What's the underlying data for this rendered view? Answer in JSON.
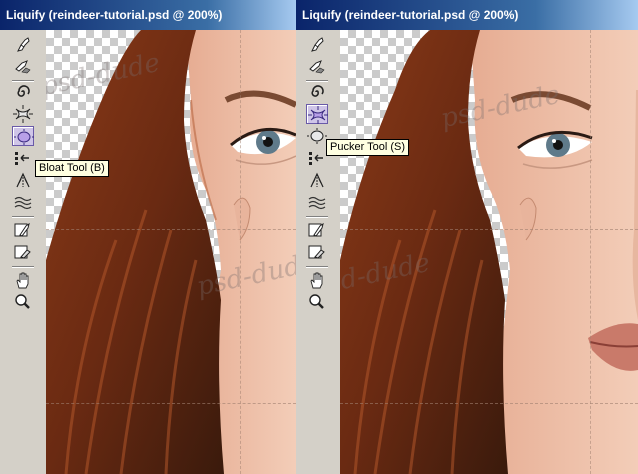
{
  "windows": [
    {
      "title": "Liquify (reindeer-tutorial.psd @ 200%)",
      "active_tool": "bloat",
      "tooltip": "Bloat Tool (B)",
      "watermark": "psd-dude"
    },
    {
      "title": "Liquify (reindeer-tutorial.psd @ 200%)",
      "active_tool": "pucker",
      "tooltip": "Pucker Tool (S)",
      "watermark": "psd-dude"
    }
  ],
  "tools": [
    {
      "name": "forward-warp",
      "icon": "finger-brush-icon"
    },
    {
      "name": "reconstruct",
      "icon": "reconstruct-brush-icon"
    },
    {
      "name": "twirl",
      "icon": "twirl-icon"
    },
    {
      "name": "pucker",
      "icon": "pucker-icon"
    },
    {
      "name": "bloat",
      "icon": "bloat-icon"
    },
    {
      "name": "push-left",
      "icon": "push-left-icon"
    },
    {
      "name": "mirror",
      "icon": "mirror-icon"
    },
    {
      "name": "turbulence",
      "icon": "turbulence-icon"
    },
    {
      "name": "freeze-mask",
      "icon": "freeze-mask-icon"
    },
    {
      "name": "thaw-mask",
      "icon": "thaw-mask-icon"
    },
    {
      "name": "hand",
      "icon": "hand-icon"
    },
    {
      "name": "zoom",
      "icon": "zoom-icon"
    }
  ],
  "colors": {
    "titlebar_start": "#0a246a",
    "titlebar_end": "#a6caf0",
    "panel": "#d4d0c8",
    "hair": "#7a3a1c",
    "skin": "#f0c4ae",
    "tooltip_bg": "#ffffe1"
  }
}
